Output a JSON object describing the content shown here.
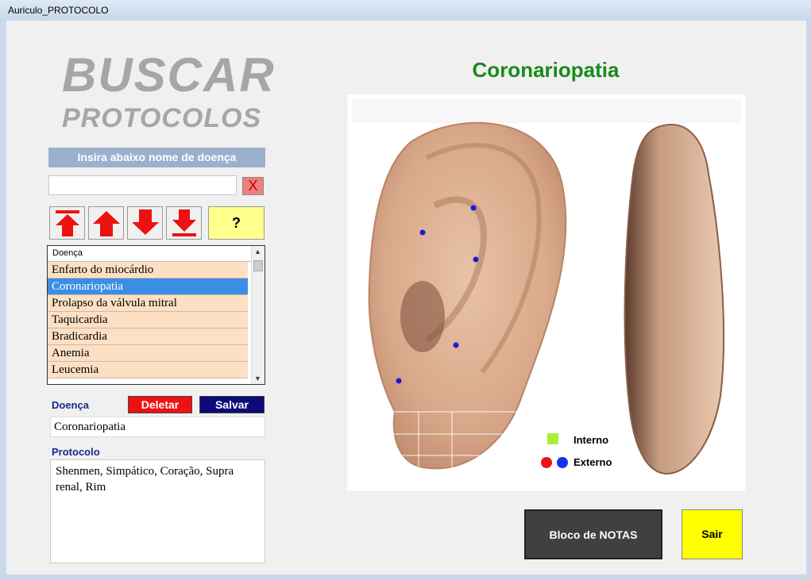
{
  "window": {
    "title": "Auriculo_PROTOCOLO"
  },
  "header": {
    "title_line1": "BUSCAR",
    "title_line2": "PROTOCOLOS"
  },
  "search": {
    "instruction": "Insira abaixo nome de doença",
    "value": "",
    "clear_label": "X"
  },
  "nav": {
    "help_label": "?",
    "icons": [
      "arrow-first-icon",
      "arrow-up-icon",
      "arrow-down-icon",
      "arrow-last-icon"
    ]
  },
  "grid": {
    "column": "Doença",
    "rows": [
      "Enfarto do miocárdio",
      "Coronariopatia",
      "Prolapso da válvula mitral",
      "Taquicardia",
      "Bradicardia",
      "Anemia",
      "Leucemia"
    ],
    "selected": "Coronariopatia"
  },
  "form": {
    "disease_label": "Doença",
    "delete_label": "Deletar",
    "save_label": "Salvar",
    "disease_value": "Coronariopatia",
    "protocol_label": "Protocolo",
    "protocol_value": "Shenmen, Simpático, Coração, Supra renal, Rim"
  },
  "main": {
    "heading": "Coronariopatia"
  },
  "legend": {
    "internal": "Interno",
    "external": "Externo"
  },
  "colors": {
    "heading": "#1a8a1a",
    "internal": "#a6f03c",
    "external_red": "#ee1111",
    "external_blue": "#1133ee",
    "point": "#1a1ad6"
  },
  "buttons": {
    "notes_label": "Bloco de NOTAS",
    "exit_label": "Sair"
  }
}
